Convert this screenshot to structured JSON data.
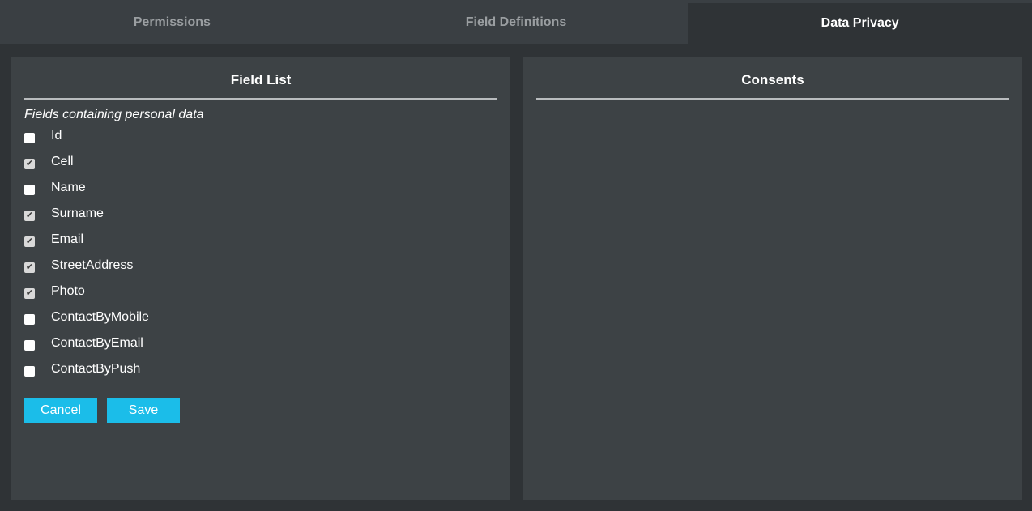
{
  "tabs": [
    {
      "label": "Permissions",
      "active": false
    },
    {
      "label": "Field Definitions",
      "active": false
    },
    {
      "label": "Data Privacy",
      "active": true
    }
  ],
  "field_list": {
    "title": "Field List",
    "subtitle": "Fields containing personal data",
    "fields": [
      {
        "label": "Id",
        "checked": false
      },
      {
        "label": "Cell",
        "checked": true
      },
      {
        "label": "Name",
        "checked": false
      },
      {
        "label": "Surname",
        "checked": true
      },
      {
        "label": "Email",
        "checked": true
      },
      {
        "label": "StreetAddress",
        "checked": true
      },
      {
        "label": "Photo",
        "checked": true
      },
      {
        "label": "ContactByMobile",
        "checked": false
      },
      {
        "label": "ContactByEmail",
        "checked": false
      },
      {
        "label": "ContactByPush",
        "checked": false
      }
    ],
    "cancel_label": "Cancel",
    "save_label": "Save"
  },
  "consents": {
    "title": "Consents"
  },
  "colors": {
    "accent": "#1bbde9",
    "background": "#2f3336",
    "panel": "#3d4245",
    "tabbar": "#3a3f43"
  }
}
